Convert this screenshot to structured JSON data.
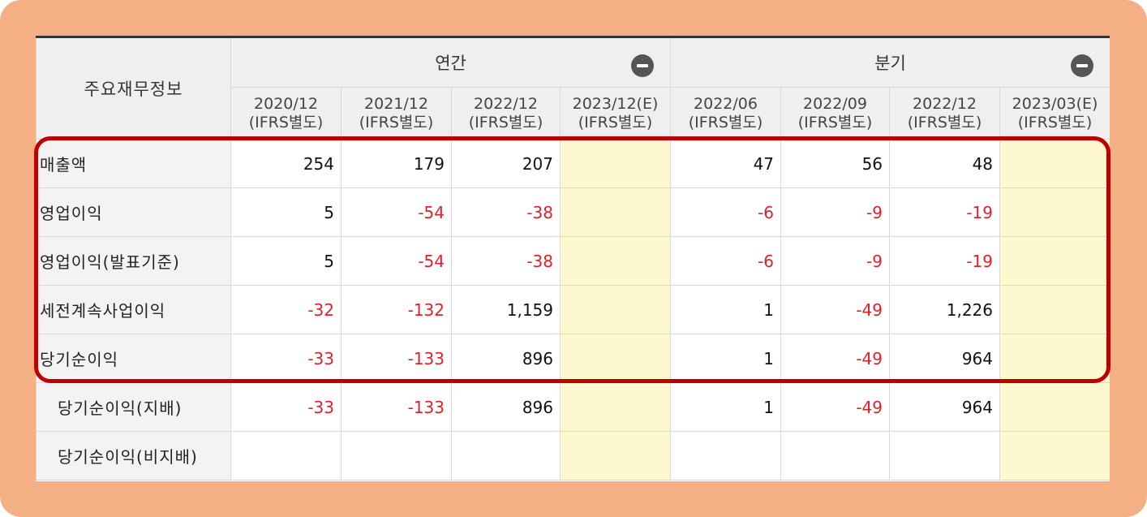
{
  "table": {
    "corner_label": "주요재무정보",
    "groups": [
      {
        "label": "연간",
        "collapse_icon": "minus-circle-icon"
      },
      {
        "label": "분기",
        "collapse_icon": "minus-circle-icon"
      }
    ],
    "periods": [
      {
        "date": "2020/12",
        "basis": "(IFRS별도)"
      },
      {
        "date": "2021/12",
        "basis": "(IFRS별도)"
      },
      {
        "date": "2022/12",
        "basis": "(IFRS별도)"
      },
      {
        "date": "2023/12(E)",
        "basis": "(IFRS별도)"
      },
      {
        "date": "2022/06",
        "basis": "(IFRS별도)"
      },
      {
        "date": "2022/09",
        "basis": "(IFRS별도)"
      },
      {
        "date": "2022/12",
        "basis": "(IFRS별도)"
      },
      {
        "date": "2023/03(E)",
        "basis": "(IFRS별도)"
      }
    ],
    "rows": [
      {
        "label": "매출액",
        "values": [
          "254",
          "179",
          "207",
          "",
          "47",
          "56",
          "48",
          ""
        ]
      },
      {
        "label": "영업이익",
        "values": [
          "5",
          "-54",
          "-38",
          "",
          "-6",
          "-9",
          "-19",
          ""
        ]
      },
      {
        "label": "영업이익(발표기준)",
        "values": [
          "5",
          "-54",
          "-38",
          "",
          "-6",
          "-9",
          "-19",
          ""
        ]
      },
      {
        "label": "세전계속사업이익",
        "values": [
          "-32",
          "-132",
          "1,159",
          "",
          "1",
          "-49",
          "1,226",
          ""
        ]
      },
      {
        "label": "당기순이익",
        "values": [
          "-33",
          "-133",
          "896",
          "",
          "1",
          "-49",
          "964",
          ""
        ]
      },
      {
        "label": "당기순이익(지배)",
        "values": [
          "-33",
          "-133",
          "896",
          "",
          "1",
          "-49",
          "964",
          ""
        ]
      },
      {
        "label": "당기순이익(비지배)",
        "values": [
          "",
          "",
          "",
          "",
          "",
          "",
          "",
          ""
        ]
      }
    ]
  },
  "colors": {
    "frame": "#f4b084",
    "highlight_border": "#c00000",
    "negative_value": "#e3202a",
    "estimate_column": "#fef8cf",
    "header_bg": "#efefef"
  }
}
